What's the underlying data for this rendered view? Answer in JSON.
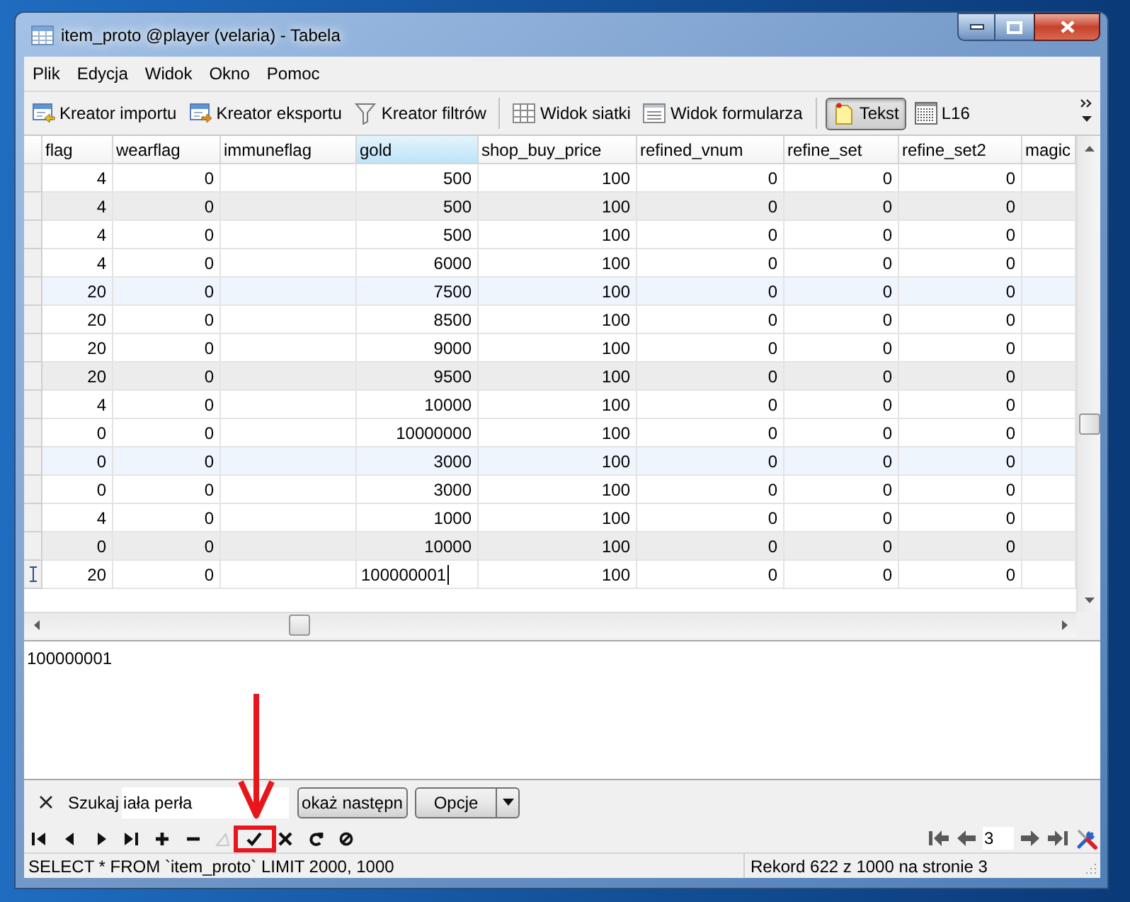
{
  "window": {
    "title": "item_proto @player (velaria) - Tabela"
  },
  "menu": [
    "Plik",
    "Edycja",
    "Widok",
    "Okno",
    "Pomoc"
  ],
  "toolbar": [
    {
      "items": [
        {
          "kind": "import",
          "label": "Kreator importu",
          "selected": false
        },
        {
          "kind": "export",
          "label": "Kreator eksportu",
          "selected": false
        },
        {
          "kind": "filter",
          "label": "Kreator filtrów",
          "selected": false
        }
      ]
    },
    {
      "items": [
        {
          "kind": "grid",
          "label": "Widok siatki",
          "selected": false
        },
        {
          "kind": "form",
          "label": "Widok formularza",
          "selected": false
        }
      ]
    },
    {
      "items": [
        {
          "kind": "text",
          "label": "Tekst",
          "selected": true
        },
        {
          "kind": "dots",
          "label": "L16",
          "selected": false
        }
      ]
    }
  ],
  "table": {
    "columns": [
      {
        "label": "flag",
        "selected": false
      },
      {
        "label": "wearflag",
        "selected": false
      },
      {
        "label": "immuneflag",
        "selected": false
      },
      {
        "label": "gold",
        "selected": true
      },
      {
        "label": "shop_buy_price",
        "selected": false
      },
      {
        "label": "refined_vnum",
        "selected": false
      },
      {
        "label": "refine_set",
        "selected": false
      },
      {
        "label": "refine_set2",
        "selected": false
      },
      {
        "label": "magic",
        "selected": false
      }
    ],
    "rows": [
      {
        "color": "#ffffff",
        "current": false,
        "cells": [
          "4",
          "0",
          null,
          "500",
          "100",
          "0",
          "0",
          "0",
          null
        ]
      },
      {
        "color": "#ececec",
        "current": false,
        "cells": [
          "4",
          "0",
          null,
          "500",
          "100",
          "0",
          "0",
          "0",
          null
        ]
      },
      {
        "color": "#ffffff",
        "current": false,
        "cells": [
          "4",
          "0",
          null,
          "500",
          "100",
          "0",
          "0",
          "0",
          null
        ]
      },
      {
        "color": "#ffffff",
        "current": false,
        "cells": [
          "4",
          "0",
          null,
          "6000",
          "100",
          "0",
          "0",
          "0",
          null
        ]
      },
      {
        "color": "#eef5fd",
        "current": false,
        "cells": [
          "20",
          "0",
          null,
          "7500",
          "100",
          "0",
          "0",
          "0",
          null
        ]
      },
      {
        "color": "#ffffff",
        "current": false,
        "cells": [
          "20",
          "0",
          null,
          "8500",
          "100",
          "0",
          "0",
          "0",
          null
        ]
      },
      {
        "color": "#ffffff",
        "current": false,
        "cells": [
          "20",
          "0",
          null,
          "9000",
          "100",
          "0",
          "0",
          "0",
          null
        ]
      },
      {
        "color": "#ececec",
        "current": false,
        "cells": [
          "20",
          "0",
          null,
          "9500",
          "100",
          "0",
          "0",
          "0",
          null
        ]
      },
      {
        "color": "#ffffff",
        "current": false,
        "cells": [
          "4",
          "0",
          null,
          "10000",
          "100",
          "0",
          "0",
          "0",
          null
        ]
      },
      {
        "color": "#ffffff",
        "current": false,
        "cells": [
          "0",
          "0",
          null,
          "10000000",
          "100",
          "0",
          "0",
          "0",
          null
        ]
      },
      {
        "color": "#eef5fd",
        "current": false,
        "cells": [
          "0",
          "0",
          null,
          "3000",
          "100",
          "0",
          "0",
          "0",
          null
        ]
      },
      {
        "color": "#ffffff",
        "current": false,
        "cells": [
          "0",
          "0",
          null,
          "3000",
          "100",
          "0",
          "0",
          "0",
          null
        ]
      },
      {
        "color": "#ffffff",
        "current": false,
        "cells": [
          "4",
          "0",
          null,
          "1000",
          "100",
          "0",
          "0",
          "0",
          null
        ]
      },
      {
        "color": "#ececec",
        "current": false,
        "cells": [
          "0",
          "0",
          null,
          "10000",
          "100",
          "0",
          "0",
          "0",
          null
        ]
      },
      {
        "color": "#ffffff",
        "current": true,
        "cells": [
          "20",
          "0",
          null,
          "100000001",
          "100",
          "0",
          "0",
          "0",
          null
        ]
      }
    ]
  },
  "text_area": {
    "value": "100000001"
  },
  "search": {
    "label": "Szukaj",
    "value": "iała perła",
    "find_next": "okaż następn",
    "options": "Opcje"
  },
  "record_nav": [
    {
      "kind": "first",
      "disabled": false
    },
    {
      "kind": "prev",
      "disabled": false
    },
    {
      "kind": "next",
      "disabled": false
    },
    {
      "kind": "last",
      "disabled": false
    },
    {
      "kind": "add",
      "disabled": false
    },
    {
      "kind": "remove",
      "disabled": false
    },
    {
      "kind": "edit",
      "disabled": true
    },
    {
      "kind": "apply",
      "disabled": false
    },
    {
      "kind": "cancel",
      "disabled": false
    },
    {
      "kind": "refresh",
      "disabled": false
    },
    {
      "kind": "stop",
      "disabled": false
    }
  ],
  "page_nav": [
    {
      "kind": "first"
    },
    {
      "kind": "prev"
    },
    {
      "kind": "page",
      "value": "3"
    },
    {
      "kind": "next"
    },
    {
      "kind": "last"
    },
    {
      "kind": "settings"
    }
  ],
  "status_bar": {
    "query": "SELECT * FROM `item_proto` LIMIT 2000, 1000",
    "record": "Rekord 622 z 1000 na stronie 3"
  }
}
